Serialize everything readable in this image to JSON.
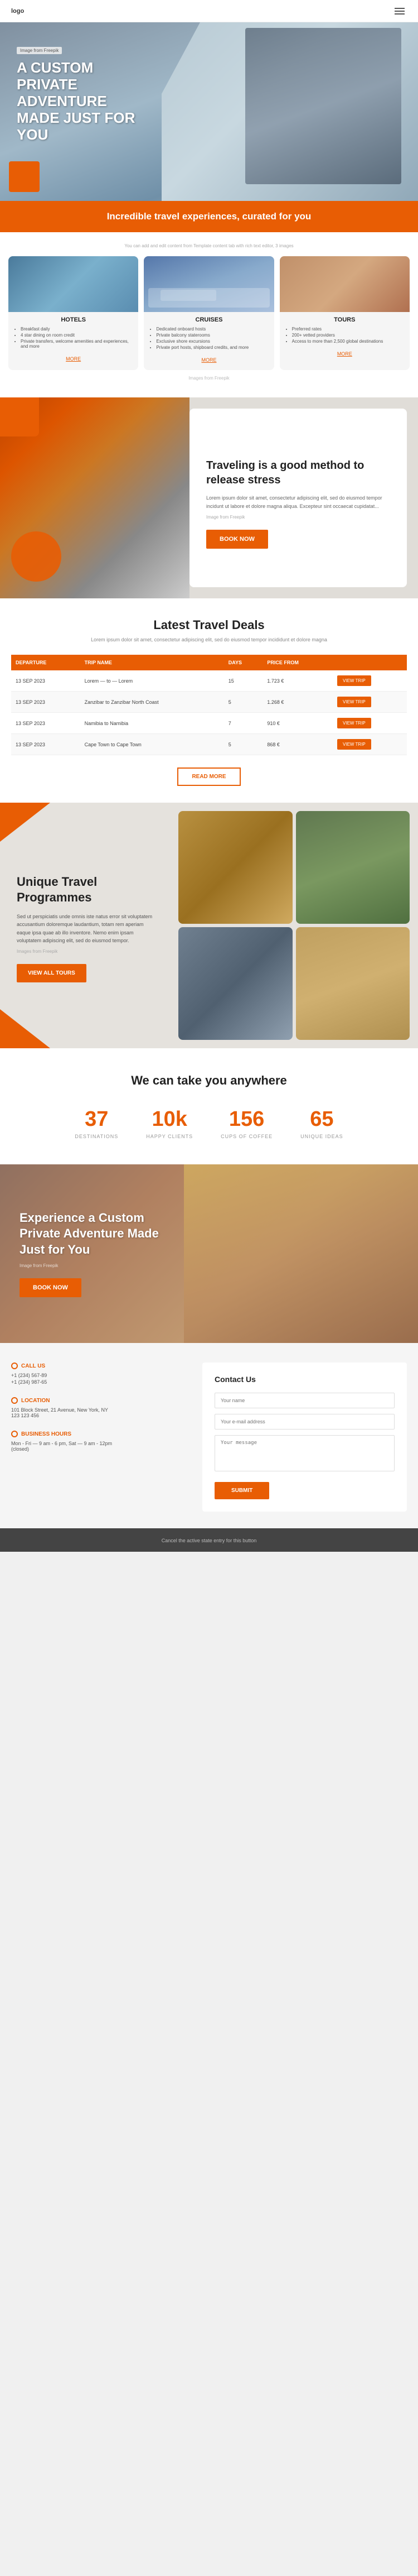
{
  "nav": {
    "logo": "logo",
    "menu_label": "menu"
  },
  "hero": {
    "tag": "Image from Freepik",
    "heading_line1": "A CUSTOM",
    "heading_line2": "PRIVATE",
    "heading_line3": "ADVENTURE",
    "heading_line4": "MADE JUST FOR",
    "heading_line5": "YOU"
  },
  "banner": {
    "text": "Incredible travel experiences, curated for you"
  },
  "cards": {
    "subtitle": "You can add and edit content from Template content tab with rich text editor, 3 images",
    "hotel": {
      "title": "HOTELS",
      "bullets": [
        "Breakfast daily",
        "4 star dining on room credit",
        "Private transfers, welcome amenities and experiences, and more"
      ],
      "more": "MORE"
    },
    "cruises": {
      "title": "CRUISES",
      "bullets": [
        "Dedicated onboard hosts",
        "Private balcony staterooms",
        "Exclusive shore excursions",
        "Private port hosts, shipboard credits, and more"
      ],
      "more": "MORE"
    },
    "tours": {
      "title": "TOURS",
      "bullets": [
        "Preferred rates",
        "200+ vetted providers",
        "Access to more than 2,500 global destinations"
      ],
      "more": "MORE"
    },
    "credit": "Images from Freepik"
  },
  "stress": {
    "heading": "Traveling is a good method to release stress",
    "body": "Lorem ipsum dolor sit amet, consectetur adipiscing elit, sed do eiusmod tempor incidunt ut labore et dolore magna aliqua. Excepteur sint occaecat cupidatat...",
    "credit": "Image from Freepik",
    "book_btn": "BOOK NOW"
  },
  "deals": {
    "title": "Latest Travel Deals",
    "subtitle": "Lorem ipsum dolor sit amet, consectetur adipiscing elit, sed do eiusmod tempor incididunt et dolore magna",
    "table": {
      "headers": [
        "DEPARTURE",
        "TRIP NAME",
        "DAYS",
        "PRICE FROM",
        ""
      ],
      "rows": [
        {
          "departure": "13 SEP 2023",
          "trip": "Lorem — to — Lorem",
          "days": "15",
          "price": "1.723 €",
          "btn": "VIEW TRIP"
        },
        {
          "departure": "13 SEP 2023",
          "trip": "Zanzibar to Zanzibar North Coast",
          "days": "5",
          "price": "1.268 €",
          "btn": "VIEW TRIP"
        },
        {
          "departure": "13 SEP 2023",
          "trip": "Namibia to Namibia",
          "days": "7",
          "price": "910 €",
          "btn": "VIEW TRIP"
        },
        {
          "departure": "13 SEP 2023",
          "trip": "Cape Town to Cape Town",
          "days": "5",
          "price": "868 €",
          "btn": "VIEW TRIP"
        }
      ]
    },
    "read_more": "READ MORE"
  },
  "programmes": {
    "title": "Unique Travel Programmes",
    "body": "Sed ut perspiciatis unde omnis iste natus error sit voluptatem accusantium doloremque laudantium, totam rem aperiam eaque ipsa quae ab illo inventore. Nemo enim ipsam voluptatem adipiscing elit, sed do eiusmod tempor.",
    "credit": "Images from Freepik",
    "btn": "VIEW ALL TOURS"
  },
  "stats": {
    "heading": "We can take you anywhere",
    "items": [
      {
        "number": "37",
        "label": "DESTINATIONS"
      },
      {
        "number": "10k",
        "label": "HAPPY CLIENTS"
      },
      {
        "number": "156",
        "label": "CUPS OF COFFEE"
      },
      {
        "number": "65",
        "label": "UNIQUE IDEAS"
      }
    ]
  },
  "experience": {
    "heading": "Experience a Custom Private Adventure Made Just for You",
    "credit": "Image from Freepik",
    "btn": "BOOK NOW"
  },
  "contact_left": {
    "call_title": "CALL US",
    "call_phone1": "+1 (234) 567-89",
    "call_phone2": "+1 (234) 987-65",
    "location_title": "LOCATION",
    "location_address": "101 Block Street, 21 Avenue, New York, NY\n123 123 456",
    "hours_title": "BUSINESS HOURS",
    "hours_text": "Mon - Fri — 9 am - 6 pm, Sat — 9 am - 12pm\n(closed)"
  },
  "contact_right": {
    "title": "Contact Us",
    "field1_placeholder": "Your name",
    "field2_placeholder": "Your e-mail address",
    "field3_placeholder": "Your message",
    "submit_btn": "SUBMIT"
  },
  "footer": {
    "text": "Cancel the active state entry for this button"
  }
}
